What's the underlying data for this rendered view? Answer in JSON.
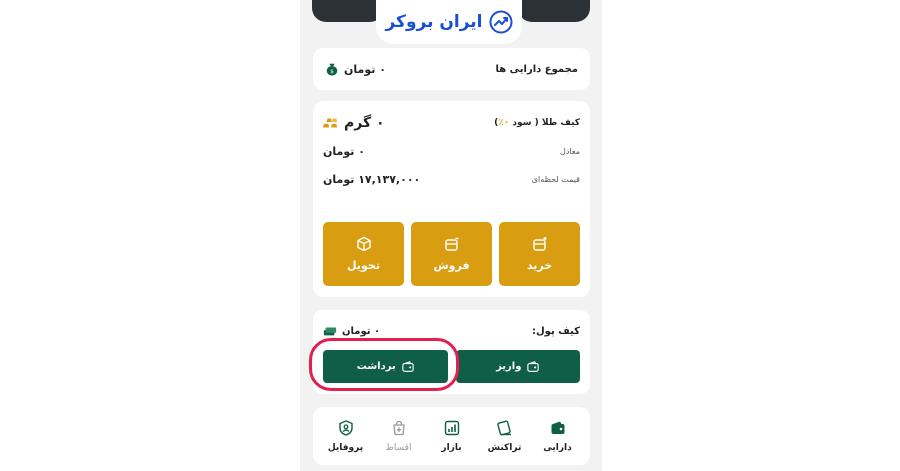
{
  "brand": {
    "name": "ایران بروکر",
    "color": "#1a4fd6"
  },
  "colors": {
    "gold": "#d99d12",
    "green": "#0f5e46",
    "highlight": "#e0214f"
  },
  "total_assets": {
    "label": "مجموع دارایی ها",
    "value": "۰ تومان",
    "icon": "money-bag-icon"
  },
  "gold_wallet": {
    "title": "کیف طلا",
    "profit_prefix": "( سود ",
    "profit_value": "۰٪",
    "profit_suffix": ")",
    "amount": "۰ گرم",
    "equivalent_label": "معادل",
    "equivalent_value": "۰ تومان",
    "price_label": "قیمت لحظه‌ای",
    "price_value": "۱۷,۱۳۷,۰۰۰ تومان",
    "buttons": {
      "buy": "خرید",
      "sell": "فروش",
      "deliver": "تحویل"
    }
  },
  "money_wallet": {
    "title": "کیف پول:",
    "amount": "۰ تومان",
    "deposit": "واریز",
    "withdraw": "برداشت"
  },
  "nav": {
    "assets": "دارایی",
    "transactions": "تراکنش",
    "market": "بازار",
    "installments": "اقساط",
    "profile": "پروفایل"
  }
}
